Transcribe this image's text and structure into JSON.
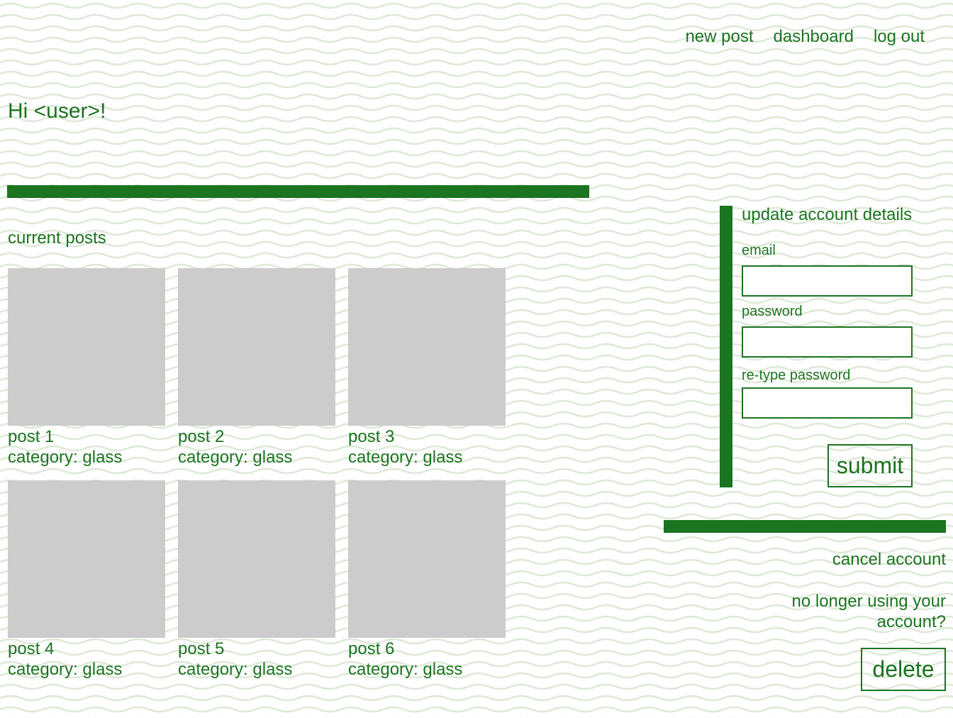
{
  "nav": {
    "new_post": "new post",
    "dashboard": "dashboard",
    "log_out": "log out"
  },
  "greeting": "Hi <user>!",
  "posts": {
    "title": "current posts",
    "items": [
      {
        "name": "post 1",
        "category": "category: glass"
      },
      {
        "name": "post 2",
        "category": "category: glass"
      },
      {
        "name": "post 3",
        "category": "category: glass"
      },
      {
        "name": "post 4",
        "category": "category: glass"
      },
      {
        "name": "post 5",
        "category": "category: glass"
      },
      {
        "name": "post 6",
        "category": "category: glass"
      }
    ]
  },
  "account": {
    "title": "update account details",
    "email_label": "email",
    "email_value": "",
    "password_label": "password",
    "password_value": "",
    "retype_label": "re-type password",
    "retype_value": "",
    "submit_label": "submit"
  },
  "cancel": {
    "title": "cancel account",
    "prompt": "no longer using your account?",
    "delete_label": "delete"
  },
  "colors": {
    "accent": "#1b7420",
    "placeholder": "#cccccc",
    "pattern": "#dde8d6"
  }
}
